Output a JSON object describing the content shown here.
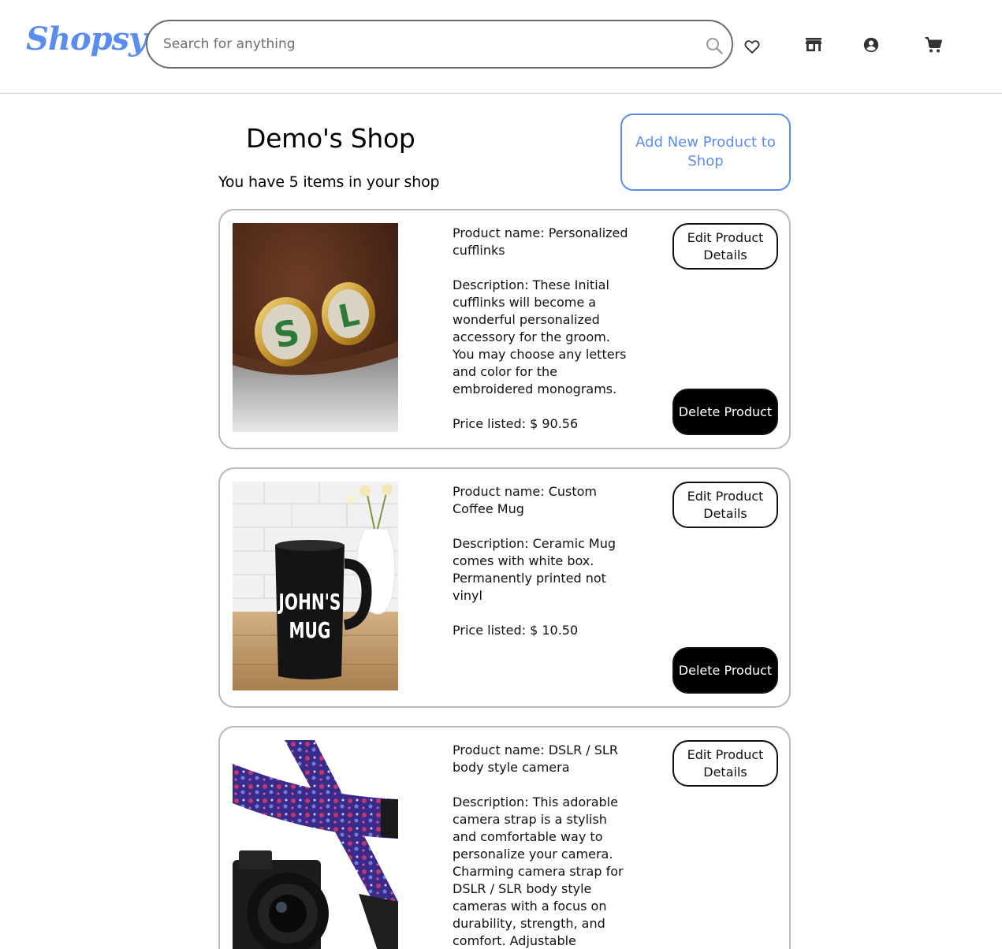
{
  "header": {
    "logo": "Shopsy",
    "search_placeholder": "Search for anything",
    "icons": [
      "search-icon",
      "heart-icon",
      "store-icon",
      "account-icon",
      "cart-icon"
    ]
  },
  "shop": {
    "title": "Demo's Shop",
    "item_count_text": "You have 5 items in your shop",
    "add_button_label": "Add New Product to Shop"
  },
  "labels": {
    "edit": "Edit Product Details",
    "delete": "Delete Product"
  },
  "products": [
    {
      "name": "Product name: Personalized cufflinks",
      "description": "Description: These Initial cufflinks will become a wonderful personalized accessory for the groom. You may choose any letters and color for the embroidered monograms.",
      "price": "Price listed: $ 90.56",
      "image": "cufflinks-photo"
    },
    {
      "name": "Product name: Custom Coffee Mug",
      "description": "Description: Ceramic Mug comes with white box. Permanently printed not vinyl",
      "price": "Price listed: $ 10.50",
      "image": "mug-photo",
      "image_text": [
        "JOHN'S",
        "MUG"
      ]
    },
    {
      "name": "Product name: DSLR / SLR body style camera",
      "description": "Description: This adorable camera strap is a stylish and comfortable way to personalize your camera. Charming camera strap for DSLR / SLR body style cameras with a focus on durability, strength, and comfort. Adjustable",
      "image": "camera-strap-photo"
    }
  ],
  "colors": {
    "accent": "#5b8def",
    "card_border": "#b9b9b9",
    "delete_bg": "#000000"
  }
}
